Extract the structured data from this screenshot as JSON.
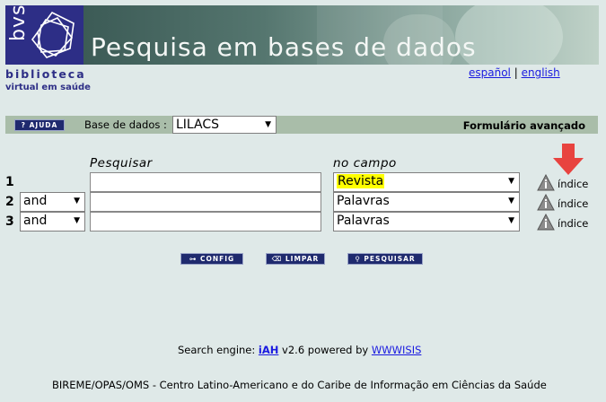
{
  "header": {
    "logo_text": "bvs",
    "banner_title": "Pesquisa em bases de dados",
    "brand_line1": "biblioteca",
    "brand_line2": "virtual em saúde",
    "lang": [
      "español",
      "english"
    ],
    "lang_sep": "|"
  },
  "db_bar": {
    "help_label": "AJUDA",
    "db_label": "Base de dados :",
    "db_value": "LILACS",
    "form_type": "Formulário avançado"
  },
  "form": {
    "search_header": "Pesquisar",
    "field_header": "no campo",
    "rows": [
      {
        "num": "1",
        "op": "",
        "query": "",
        "field": "Revista",
        "index_label": "índice"
      },
      {
        "num": "2",
        "op": "and",
        "query": "",
        "field": "Palavras",
        "index_label": "índice"
      },
      {
        "num": "3",
        "op": "and",
        "query": "",
        "field": "Palavras",
        "index_label": "índice"
      }
    ]
  },
  "actions": {
    "config": "CONFIG",
    "limpar": "LIMPAR",
    "pesquisar": "PESQUISAR"
  },
  "footer": {
    "engine_prefix": "Search engine: ",
    "engine_link": "iAH",
    "engine_mid": " v2.6 powered by ",
    "engine_powered": "WWWISIS",
    "credit": "BIREME/OPAS/OMS - Centro Latino-Americano e do Caribe de Informação em Ciências da Saúde"
  },
  "colors": {
    "brand_navy": "#2d2e86",
    "bar_green": "#a9bda9",
    "highlight": "#ffff00",
    "arrow_red": "#e8433f",
    "link": "#1a1ae0"
  }
}
